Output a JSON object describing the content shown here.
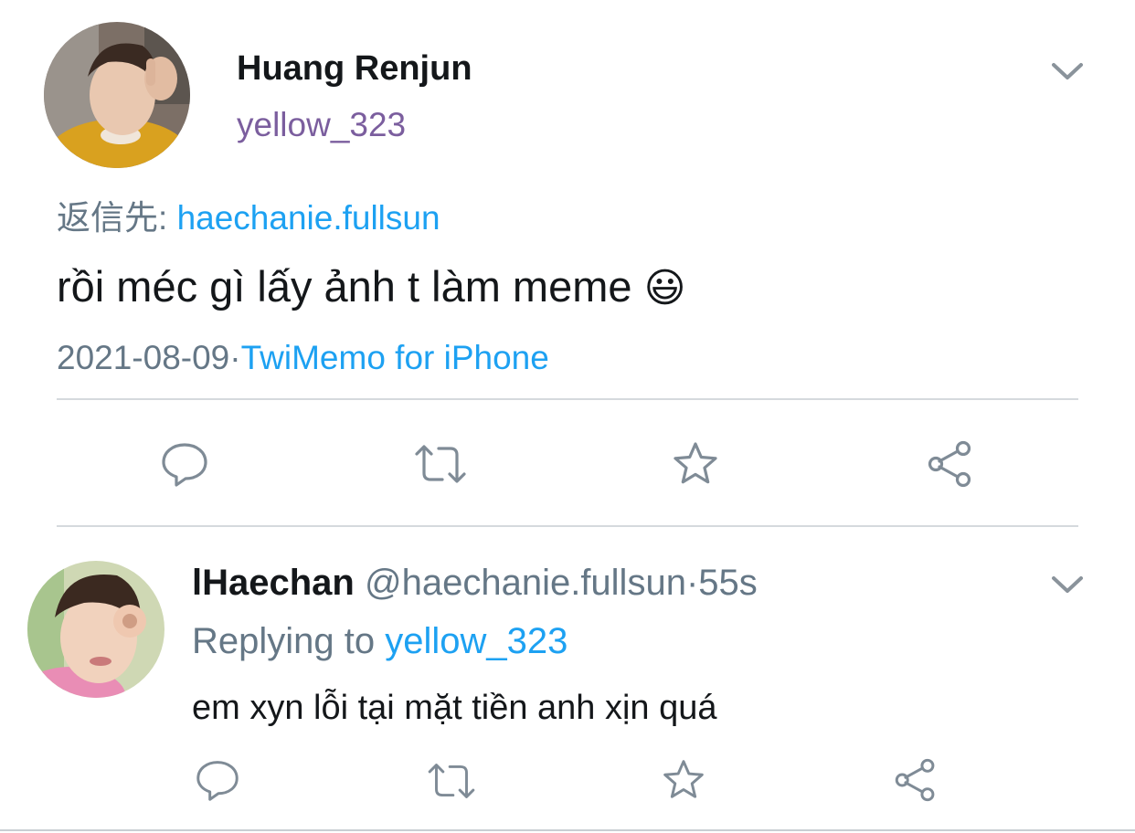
{
  "tweet": {
    "author_name": "Huang Renjun",
    "author_handle": "yellow_323",
    "reply_prefix": "返信先:",
    "reply_to": "haechanie.fullsun",
    "text": "rồi méc gì lấy ảnh t làm meme",
    "emoji": "😃",
    "date": "2021-08-09",
    "separator": "·",
    "source": "TwiMemo for iPhone",
    "avatar_icon": "avatar-photo-icon",
    "menu_icon": "chevron-down-icon",
    "actions": [
      "reply-icon",
      "retweet-icon",
      "favorite-icon",
      "share-icon"
    ]
  },
  "reply": {
    "author_name": "lHaechan",
    "author_handle": "@haechanie.fullsun",
    "separator": "·",
    "time": "55s",
    "replying_label": "Replying to",
    "replying_to": "yellow_323",
    "text": "em xyn lỗi tại mặt tiền anh xịn quá",
    "avatar_icon": "avatar-photo-icon",
    "menu_icon": "chevron-down-icon",
    "actions": [
      "reply-icon",
      "retweet-icon",
      "favorite-icon",
      "share-icon"
    ]
  },
  "colors": {
    "link": "#1da1f2",
    "muted": "#657786",
    "handle_purple": "#7b5e9e",
    "text": "#14171a",
    "divider": "#d5d9dd"
  }
}
